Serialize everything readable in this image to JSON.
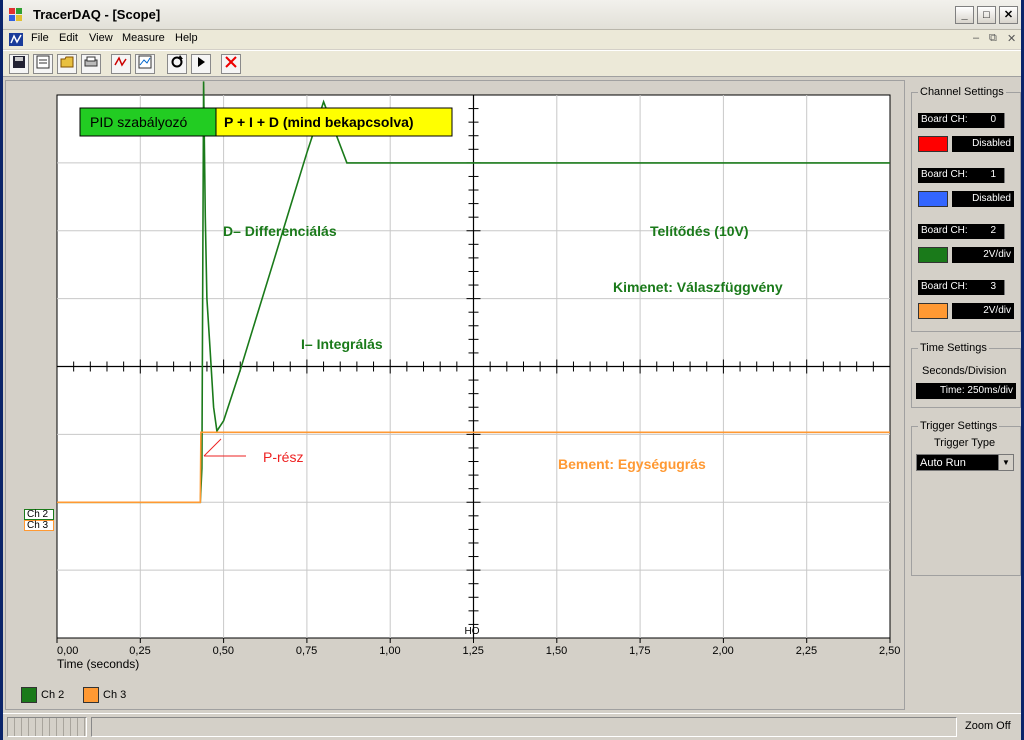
{
  "window": {
    "title": "TracerDAQ - [Scope]",
    "caption_buttons": [
      "_",
      "□",
      "✕"
    ]
  },
  "menu": {
    "items": [
      "File",
      "Edit",
      "View",
      "Measure",
      "Help"
    ],
    "mdi_buttons": [
      "–",
      "⧉",
      "✕"
    ]
  },
  "toolbar": {
    "icons": [
      "save-icon",
      "properties-icon",
      "open-icon",
      "print-icon",
      "channel-icon",
      "chart-icon",
      "refresh-icon",
      "play-icon",
      "stop-icon"
    ]
  },
  "plot": {
    "legend_pid": "PID szabályozó",
    "legend_mode": "P + I + D  (mind bekapcsolva)",
    "annot_d": "D– Differenciálás",
    "annot_sat": "Telítődés (10V)",
    "annot_out": "Kimenet: Válaszfüggvény",
    "annot_i": "I– Integrálás",
    "annot_p": "P-rész",
    "annot_in": "Bement: Egységugrás",
    "ho_label": "HO",
    "xlabel": "Time (seconds)",
    "xticks": [
      "0,00",
      "0,25",
      "0,50",
      "0,75",
      "1,00",
      "1,25",
      "1,50",
      "1,75",
      "2,00",
      "2,25",
      "2,50"
    ],
    "ch2_tag": "Ch 2",
    "ch3_tag": "Ch 3"
  },
  "colors": {
    "ch0": "#ff0000",
    "ch1": "#3366ff",
    "ch2": "#1a7a1a",
    "ch3": "#ff9933",
    "pid_box": "#22cc22",
    "mode_box": "#ffff00",
    "p_annot": "#ee2222"
  },
  "channel_settings": {
    "title": "Channel Settings",
    "channels": [
      {
        "board_label": "Board CH:",
        "board_value": "0",
        "state": "Disabled"
      },
      {
        "board_label": "Board CH:",
        "board_value": "1",
        "state": "Disabled"
      },
      {
        "board_label": "Board CH:",
        "board_value": "2",
        "state": "2V/div"
      },
      {
        "board_label": "Board CH:",
        "board_value": "3",
        "state": "2V/div"
      }
    ]
  },
  "time_settings": {
    "title": "Time Settings",
    "label": "Seconds/Division",
    "value": "Time: 250ms/div"
  },
  "trigger_settings": {
    "title": "Trigger Settings",
    "label": "Trigger Type",
    "value": "Auto Run"
  },
  "bottom_legend": {
    "items": [
      {
        "label": "Ch 2"
      },
      {
        "label": "Ch 3"
      }
    ]
  },
  "status": {
    "zoom": "Zoom Off"
  },
  "chart_data": {
    "type": "line",
    "xlabel": "Time (seconds)",
    "xlim": [
      0,
      2.5
    ],
    "x_divisions": 10,
    "y_divisions": 8,
    "grid": true,
    "series": [
      {
        "name": "Ch 2",
        "color": "#1a7a1a",
        "x": [
          0,
          0.43,
          0.435,
          0.44,
          0.445,
          0.45,
          0.46,
          0.47,
          0.48,
          0.5,
          0.55,
          0.6,
          0.65,
          0.7,
          0.75,
          0.8,
          0.87,
          1.0,
          1.5,
          2.0,
          2.5
        ],
        "y": [
          -2,
          -2,
          -1.5,
          4.2,
          2.2,
          1.0,
          0.2,
          -0.6,
          -0.95,
          -0.8,
          -0.05,
          0.75,
          1.55,
          2.35,
          3.15,
          3.9,
          3.0,
          3.0,
          3.0,
          3.0,
          3.0
        ]
      },
      {
        "name": "Ch 3",
        "color": "#ff9933",
        "x": [
          0,
          0.43,
          0.432,
          0.45,
          1.0,
          2.5
        ],
        "y": [
          -2,
          -2,
          -0.97,
          -0.97,
          -0.97,
          -0.97
        ]
      }
    ]
  }
}
